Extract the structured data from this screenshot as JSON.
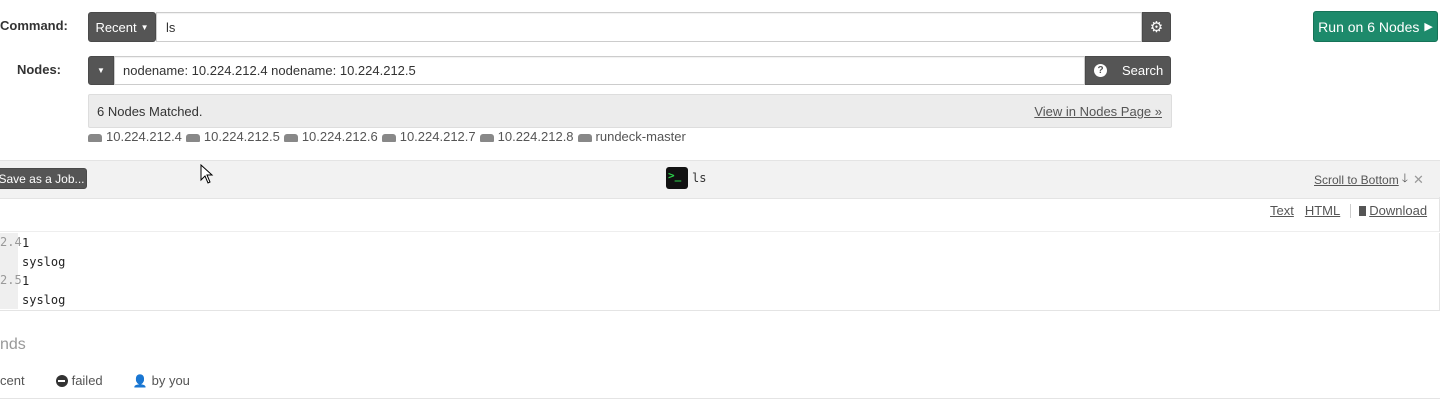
{
  "command": {
    "label": "Command:",
    "recent_label": "Recent",
    "value": "ls",
    "run_button": "Run on 6 Nodes"
  },
  "nodes": {
    "label": "Nodes:",
    "filter_value": "nodename: 10.224.212.4 nodename: 10.224.212.5",
    "search_button": "Search",
    "matched_text": "6 Nodes Matched.",
    "view_link": "View in Nodes Page »",
    "list": [
      "10.224.212.4",
      "10.224.212.5",
      "10.224.212.6",
      "10.224.212.7",
      "10.224.212.8",
      "rundeck-master"
    ]
  },
  "output": {
    "save_job_button": "Save as a Job...",
    "command_text": "ls",
    "scroll_to_bottom": "Scroll to Bottom",
    "formats": {
      "text": "Text",
      "html": "HTML",
      "download": "Download"
    },
    "rows": [
      {
        "node": "2.4",
        "line": "1"
      },
      {
        "node": "",
        "line": "syslog"
      },
      {
        "node": "2.5",
        "line": "1"
      },
      {
        "node": "",
        "line": "syslog"
      }
    ]
  },
  "history": {
    "title": "nds",
    "filters": {
      "recent": "cent",
      "failed": "failed",
      "by_you": "by you"
    }
  },
  "colors": {
    "run_button": "#1d8a6b",
    "terminal_prompt": "#2bd24b",
    "dark_button": "#555555"
  }
}
